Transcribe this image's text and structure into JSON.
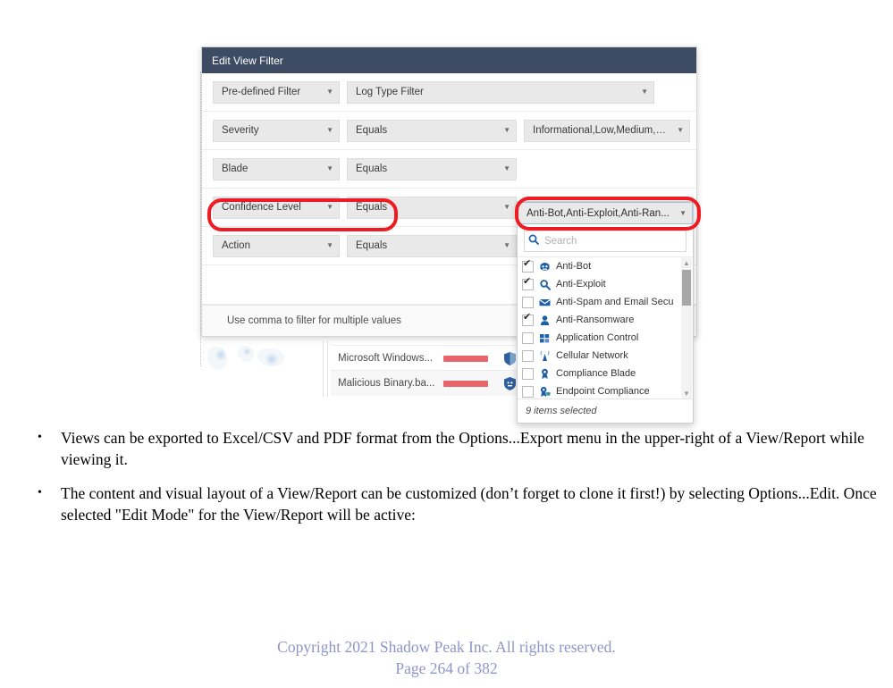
{
  "figure": {
    "dialog": {
      "title": "Edit View Filter",
      "rows": [
        {
          "field": "Pre-defined Filter",
          "wide": "Log Type Filter"
        },
        {
          "field": "Severity",
          "operator": "Equals",
          "value": "Informational,Low,Medium,Hi..."
        },
        {
          "field": "Blade",
          "operator": "Equals",
          "value": "Anti-Bot,Anti-Exploit,Anti-Ran..."
        },
        {
          "field": "Confidence Level",
          "operator": "Equals",
          "value": ""
        },
        {
          "field": "Action",
          "operator": "Equals",
          "value": ""
        }
      ],
      "hint": "Use comma to filter for multiple values"
    },
    "dropdown": {
      "trigger_value": "Anti-Bot,Anti-Exploit,Anti-Ran...",
      "search_placeholder": "Search",
      "items": [
        {
          "label": "Anti-Bot",
          "checked": true,
          "icon": "anti-bot-icon"
        },
        {
          "label": "Anti-Exploit",
          "checked": true,
          "icon": "anti-exploit-icon"
        },
        {
          "label": "Anti-Spam and Email Secu",
          "checked": false,
          "icon": "envelope-icon"
        },
        {
          "label": "Anti-Ransomware",
          "checked": true,
          "icon": "anti-ransomware-icon"
        },
        {
          "label": "Application Control",
          "checked": false,
          "icon": "application-control-icon"
        },
        {
          "label": "Cellular Network",
          "checked": false,
          "icon": "cellular-network-icon"
        },
        {
          "label": "Compliance Blade",
          "checked": false,
          "icon": "compliance-badge-icon"
        },
        {
          "label": "Endpoint Compliance",
          "checked": false,
          "icon": "endpoint-compliance-icon"
        }
      ],
      "footer": "9 items selected"
    },
    "background_rows": [
      {
        "name": "Microsoft Windows...",
        "shield": "shield-striped-icon"
      },
      {
        "name": "Malicious Binary.ba...",
        "shield": "shield-bot-icon"
      }
    ],
    "annotations": [
      {
        "name": "blade-row-highlight",
        "color": "#ee1c22"
      },
      {
        "name": "blade-value-highlight",
        "color": "#ee1c22"
      }
    ]
  },
  "content": {
    "bullets": [
      "Views can be exported to Excel/CSV and PDF format from the Options...Export menu in the upper-right of a View/Report while viewing it.",
      "The content and visual layout of a View/Report can be customized (don’t forget to clone it first!) by selecting Options...Edit. Once selected \"Edit Mode\" for the View/Report will be active:"
    ],
    "bullet_marker": "•"
  },
  "footer": {
    "copyright": "Copyright 2021 Shadow Peak Inc.  All rights reserved.",
    "page": "Page 264 of 382"
  }
}
